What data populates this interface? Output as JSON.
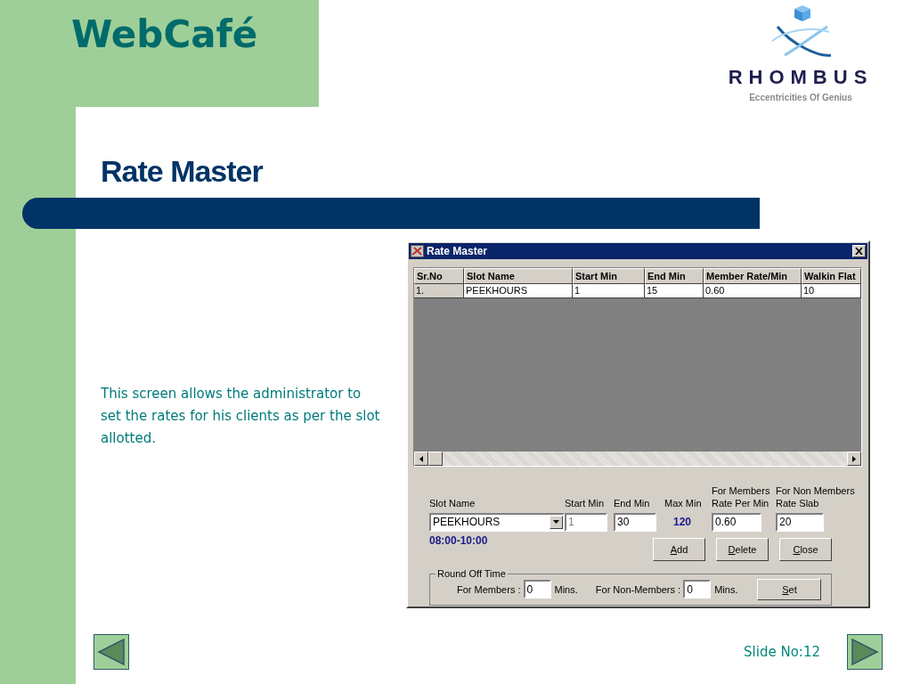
{
  "header": {
    "title": "WebCafé"
  },
  "logo": {
    "name": "RHOMBUS",
    "tagline": "Eccentricities Of Genius"
  },
  "slide_title": "Rate Master",
  "description": "This screen allows the administrator to set the rates for his clients as per the slot allotted.",
  "window": {
    "title": "Rate Master",
    "table": {
      "columns": [
        "Sr.No",
        "Slot Name",
        "Start Min",
        "End Min",
        "Member Rate/Min",
        "Walkin Flat"
      ],
      "rows": [
        [
          "1.",
          "PEEKHOURS",
          "1",
          "15",
          "0.60",
          "10"
        ]
      ]
    },
    "form": {
      "slot_name": {
        "label": "Slot Name",
        "value": "PEEKHOURS"
      },
      "fields": [
        {
          "kind": "input",
          "label": "Start Min",
          "value": "1",
          "disabled": true
        },
        {
          "kind": "input",
          "label": "End Min",
          "value": "30",
          "disabled": false
        },
        {
          "kind": "readout",
          "label": "Max Min",
          "value": "120"
        },
        {
          "kind": "input",
          "label": "For Members Rate Per Min",
          "value": "0.60",
          "disabled": false
        },
        {
          "kind": "input",
          "label": "For Non Members Rate Slab",
          "value": "20",
          "disabled": false
        }
      ],
      "slot_time": "08:00-10:00",
      "buttons": [
        "Add",
        "Delete",
        "Close"
      ],
      "round_off": {
        "title": "Round Off Time",
        "members": {
          "label": "For Members :",
          "value": "0",
          "unit": "Mins."
        },
        "non_members": {
          "label": "For Non-Members :",
          "value": "0",
          "unit": "Mins."
        },
        "button": "Set"
      }
    }
  },
  "footer": {
    "slide_number": "Slide No:12"
  }
}
